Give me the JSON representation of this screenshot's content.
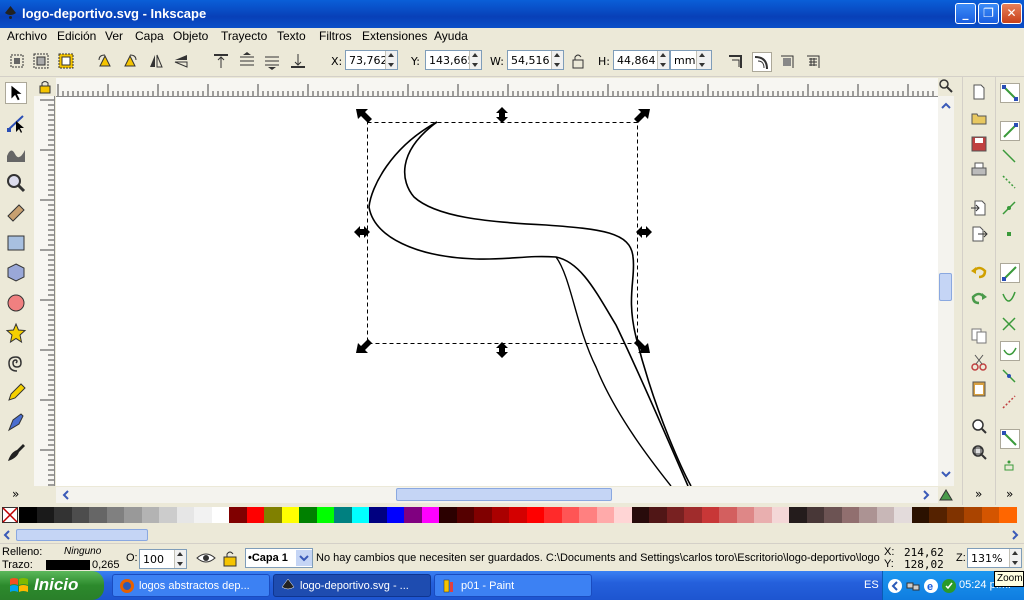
{
  "window": {
    "title": "logo-deportivo.svg - Inkscape"
  },
  "menubar": {
    "items": [
      "Archivo",
      "Edición",
      "Ver",
      "Capa",
      "Objeto",
      "Trayecto",
      "Texto",
      "Filtros",
      "Extensiones",
      "Ayuda"
    ]
  },
  "toolbar": {
    "x_label": "X:",
    "x_value": "73,762",
    "y_label": "Y:",
    "y_value": "143,665",
    "w_label": "W:",
    "w_value": "54,516",
    "h_label": "H:",
    "h_value": "44,864",
    "unit": "mm"
  },
  "status": {
    "fill_label": "Relleno:",
    "fill_value": "Ninguno",
    "stroke_label": "Trazo:",
    "stroke_width": "0,265",
    "opacity_label": "O:",
    "opacity_value": "100",
    "layer": "•Capa 1",
    "message": "No hay cambios que necesiten ser guardados. C:\\Documents and Settings\\carlos toro\\Escritorio\\logo-deportivo\\logo...",
    "coord_x_label": "X:",
    "coord_x": "214,62",
    "coord_y_label": "Y:",
    "coord_y": "128,02",
    "zoom_label": "Z:",
    "zoom": "131%",
    "tooltip": "Zoom"
  },
  "taskbar": {
    "start": "Inicio",
    "tasks": [
      "logos abstractos dep...",
      "logo-deportivo.svg - ...",
      "p01 - Paint"
    ],
    "lang": "ES",
    "clock": "05:24 p.m."
  },
  "colors": {
    "accent": "#0a5fd8",
    "taskbar": "#245edb",
    "start": "#3c9a3c"
  },
  "palette": [
    "#000000",
    "#1a1a1a",
    "#333333",
    "#4d4d4d",
    "#666666",
    "#808080",
    "#999999",
    "#b3b3b3",
    "#cccccc",
    "#e6e6e6",
    "#f2f2f2",
    "#ffffff",
    "#800000",
    "#ff0000",
    "#808000",
    "#ffff00",
    "#008000",
    "#00ff00",
    "#008080",
    "#00ffff",
    "#000080",
    "#0000ff",
    "#800080",
    "#ff00ff",
    "#2b0000",
    "#550000",
    "#800000",
    "#aa0000",
    "#d40000",
    "#ff0000",
    "#ff2a2a",
    "#ff5555",
    "#ff8080",
    "#ffaaaa",
    "#ffd5d5",
    "#280b0b",
    "#501616",
    "#782121",
    "#a02c2c",
    "#c83737",
    "#d35f5f",
    "#de8787",
    "#e9afaf",
    "#f4d7d7",
    "#241c1c",
    "#483737",
    "#6c5353",
    "#916f6f",
    "#ac9393",
    "#c8b7b7",
    "#e3dbdb",
    "#2b1100",
    "#552200",
    "#803300",
    "#aa4400",
    "#d45500",
    "#ff6600"
  ]
}
